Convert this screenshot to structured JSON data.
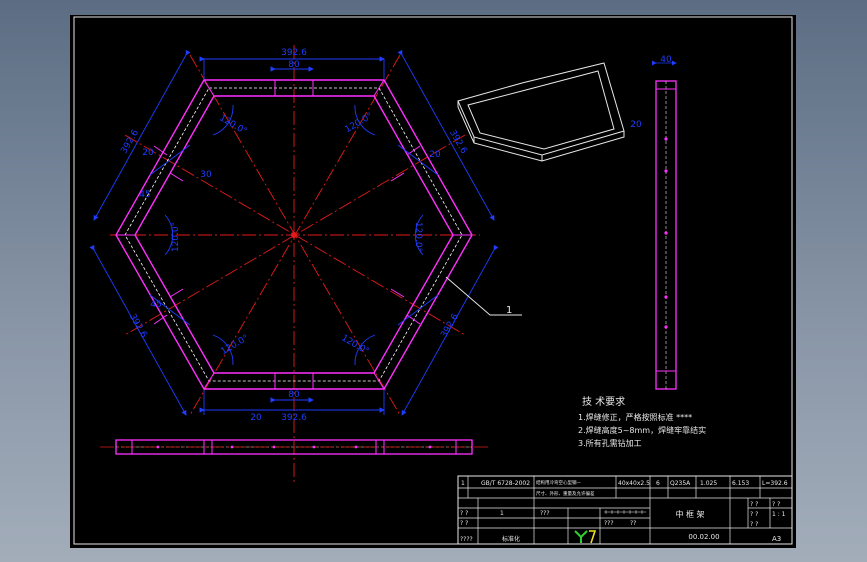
{
  "drawing": {
    "dims": {
      "top_length": "392.6",
      "top_inner": "80",
      "top_right_angle": "120.0°",
      "top_left_angle": "120.0°",
      "upper_left_side": "392.6",
      "upper_right_side": "392.6",
      "left_upper_20": "20",
      "left_upper_45": "45",
      "left_upper_30": "30",
      "left_angle": "120.0°",
      "right_angle": "120.0°",
      "right_upper_20": "20",
      "lower_left_side": "392.6",
      "lower_right_side": "392.6",
      "lower_left_45": "45",
      "bottom_left_angle": "120.0°",
      "bottom_right_angle": "120.0°",
      "bottom_inner": "80",
      "bottom_length": "392.6",
      "bottom_20": "20",
      "side_view_width": "40",
      "side_view_20": "20"
    },
    "leader_label": "1"
  },
  "notes": {
    "title": "技 术要求",
    "items": [
      "1.焊缝修正，严格按照标准 ****",
      "2.焊缝高度5~8mm，焊缝牢靠结实",
      "3.所有孔需钻加工"
    ]
  },
  "title_block": {
    "row1": {
      "no": "1",
      "standard": "GB/T 6728-2002",
      "desc": "结构用冷弯空心型钢—",
      "spec": "40x40x2.5",
      "qty": "6",
      "material": "Q235A",
      "unit_weight": "1.025",
      "total_weight": "6.153",
      "note": "L=392.6"
    },
    "row1b": "尺寸、外形、重量及允许偏差",
    "row2": {
      "a": "? ?",
      "b": "1",
      "c": "???"
    },
    "row3": {
      "a": "? ?",
      "b": "???",
      "c": "??",
      "d": "? ?"
    },
    "row4": {
      "a": "????",
      "b": "标准化"
    },
    "part_name": "中 框 架",
    "part_no": "00.02.00",
    "sheet": "A3",
    "scale_cells": [
      "? ?",
      "? ?",
      "? ?",
      "1 : 1",
      "? ?"
    ]
  }
}
